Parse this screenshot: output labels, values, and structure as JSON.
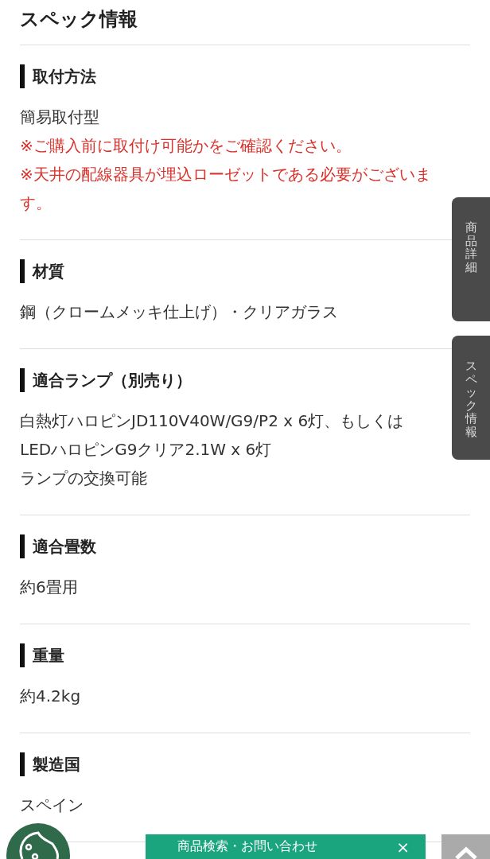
{
  "title": "スペック情報",
  "sections": [
    {
      "heading": "取付方法",
      "lines": [
        {
          "kind": "normal",
          "text": "簡易取付型"
        },
        {
          "kind": "note",
          "text": "※ご購入前に取付け可能かをご確認ください。"
        },
        {
          "kind": "note",
          "text": "※天井の配線器具が埋込ローゼットである必要がございます。"
        }
      ]
    },
    {
      "heading": "材質",
      "lines": [
        {
          "kind": "normal",
          "text": "鋼（クロームメッキ仕上げ）・クリアガラス"
        }
      ]
    },
    {
      "heading": "適合ランプ（別売り）",
      "lines": [
        {
          "kind": "normal",
          "text": "白熱灯ハロピンJD110V40W/G9/P2 x 6灯、もしくは"
        },
        {
          "kind": "normal",
          "text": "LEDハロピンG9クリア2.1W x 6灯"
        },
        {
          "kind": "normal",
          "text": "ランプの交換可能"
        }
      ]
    },
    {
      "heading": "適合畳数",
      "lines": [
        {
          "kind": "normal",
          "text": "約6畳用"
        }
      ]
    },
    {
      "heading": "重量",
      "lines": [
        {
          "kind": "normal",
          "text": "約4.2kg"
        }
      ]
    },
    {
      "heading": "製造国",
      "lines": [
        {
          "kind": "normal",
          "text": "スペイン"
        }
      ]
    }
  ],
  "side_tabs": [
    {
      "label": "商品詳細"
    },
    {
      "label": "スペック情報"
    }
  ],
  "search_button": {
    "label": "商品検索・お問い合わせ",
    "close": "×"
  }
}
